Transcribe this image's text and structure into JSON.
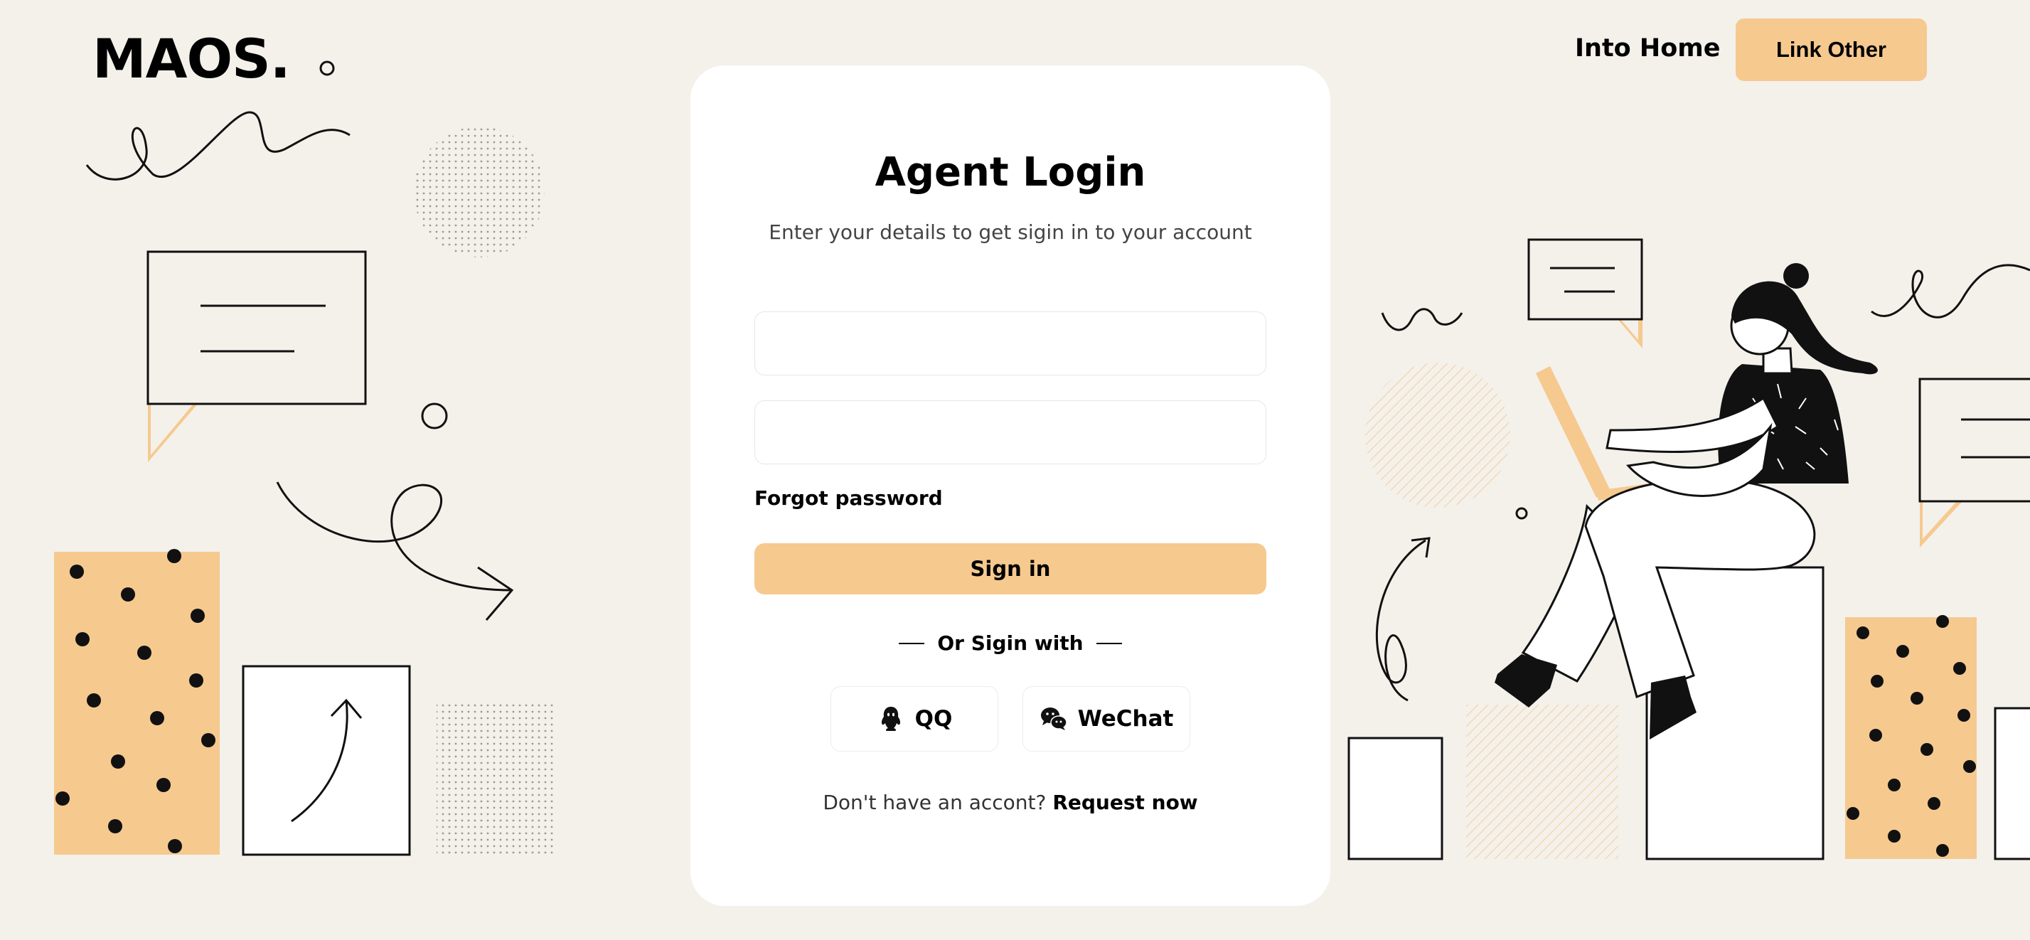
{
  "header": {
    "brand": "MAOS.",
    "nav_link": "Into Home",
    "nav_button": "Link Other"
  },
  "login": {
    "title": "Agent Login",
    "subtitle": "Enter your details to get sigin in to your account",
    "username": {
      "value": "",
      "placeholder": ""
    },
    "password": {
      "value": "",
      "placeholder": ""
    },
    "forgot": "Forgot password",
    "submit": "Sign in",
    "divider": "Or Sigin with",
    "social": [
      {
        "label": "QQ",
        "icon": "qq-icon"
      },
      {
        "label": "WeChat",
        "icon": "wechat-icon"
      }
    ],
    "footer_text": "Don't have an accont?",
    "footer_link": "Request now"
  },
  "colors": {
    "background": "#f4f1eb",
    "accent": "#f6c98f",
    "card": "#ffffff"
  }
}
